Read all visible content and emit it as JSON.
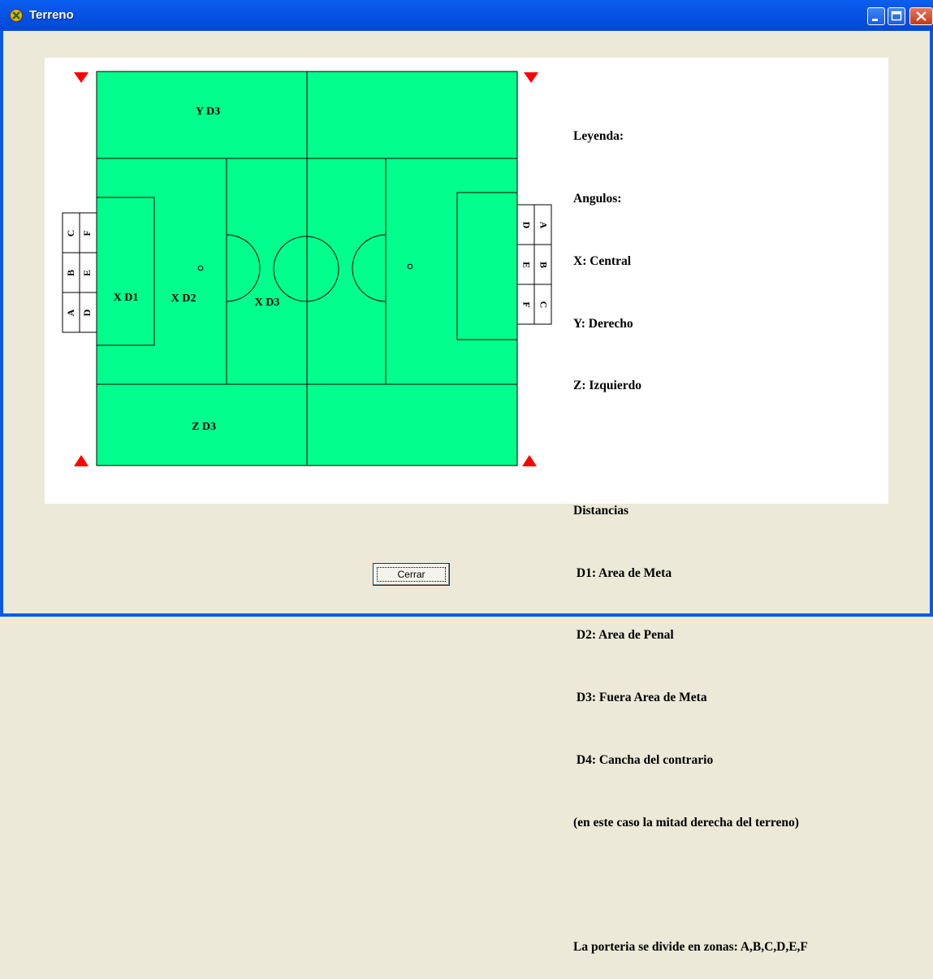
{
  "window": {
    "title": "Terreno",
    "colors": {
      "titlebar": "#0A5FF0",
      "field": "#00FF8C",
      "corner_marker": "#FF0000",
      "face": "#ECE9D8"
    }
  },
  "field": {
    "zone_labels": {
      "y_d3": "Y D3",
      "x_d1": "X D1",
      "x_d2": "X D2",
      "x_d3": "X D3",
      "z_d3": "Z D3"
    },
    "left_goal_zones": {
      "top": [
        "C",
        "F"
      ],
      "middle": [
        "B",
        "E"
      ],
      "bottom": [
        "A",
        "D"
      ]
    },
    "right_goal_zones": {
      "top": [
        "D",
        "A"
      ],
      "middle": [
        "E",
        "B"
      ],
      "bottom": [
        "F",
        "C"
      ]
    }
  },
  "legend": {
    "lines": [
      "Leyenda:",
      "Angulos:",
      "X: Central",
      "Y: Derecho",
      "Z: Izquierdo",
      "",
      "Distancias",
      " D1: Area de Meta",
      " D2: Area de Penal",
      " D3: Fuera Area de Meta",
      " D4: Cancha del contrario",
      "(en este caso la mitad derecha del terreno)",
      "",
      "La porteria se divide en zonas: A,B,C,D,E,F"
    ]
  },
  "buttons": {
    "close_label": "Cerrar"
  }
}
